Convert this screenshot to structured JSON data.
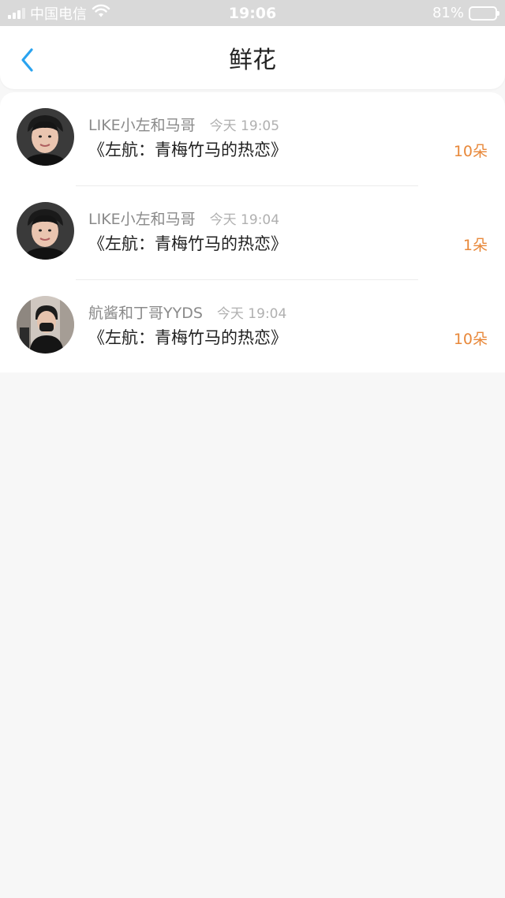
{
  "status_bar": {
    "carrier": "中国电信",
    "time": "19:06",
    "battery_percent": "81%",
    "battery_level": 0.81,
    "icons": [
      "signal-icon",
      "wifi-icon",
      "battery-icon"
    ]
  },
  "nav": {
    "title": "鲜花",
    "back_icon": "chevron-left-icon",
    "accent_color": "#2aa3ef"
  },
  "gifts": [
    {
      "sender": "LIKE小左和马哥",
      "time": "今天 19:05",
      "title": "《左航：青梅竹马的热恋》",
      "amount": "10朵"
    },
    {
      "sender": "LIKE小左和马哥",
      "time": "今天 19:04",
      "title": "《左航：青梅竹马的热恋》",
      "amount": "1朵"
    },
    {
      "sender": "航酱和丁哥YYDS",
      "time": "今天 19:04",
      "title": "《左航：青梅竹马的热恋》",
      "amount": "10朵"
    }
  ],
  "colors": {
    "amount": "#e8883a",
    "background": "#f7f7f7"
  }
}
